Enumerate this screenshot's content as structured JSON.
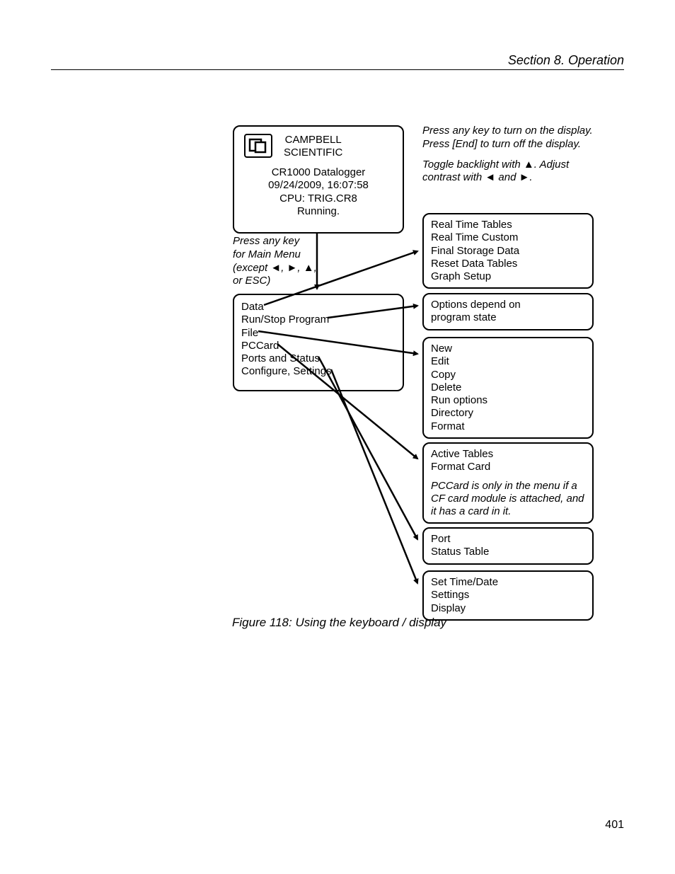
{
  "header": {
    "section": "Section 8.  Operation"
  },
  "pageNumber": "401",
  "caption": "Figure 118: Using the keyboard / display",
  "topInstr": {
    "l1": "Press any key to turn on the display.",
    "l2": "Press [End] to turn off the display.",
    "l3": "Toggle backlight with ▲. Adjust contrast with ◄ and ►."
  },
  "boxA": {
    "brand1": "CAMPBELL",
    "brand2": "SCIENTIFIC",
    "l1": "CR1000 Datalogger",
    "l2": "09/24/2009,  16:07:58",
    "l3": "CPU:  TRIG.CR8",
    "l4": "Running."
  },
  "sideInstr": {
    "l1": "Press any key",
    "l2": "for Main Menu",
    "l3": "(except ◄, ►, ▲,",
    "l4": "or ESC)"
  },
  "boxB": {
    "i0": "Data",
    "i1": "Run/Stop Program",
    "i2": "File",
    "i3": "PCCard",
    "i4": "Ports and Status",
    "i5": "Configure, Settings"
  },
  "boxC": {
    "i0": "Real Time Tables",
    "i1": "Real Time Custom",
    "i2": "Final Storage Data",
    "i3": "Reset Data Tables",
    "i4": "Graph Setup"
  },
  "boxD": {
    "i0": "Options depend on",
    "i1": "program state"
  },
  "boxE": {
    "i0": "New",
    "i1": "Edit",
    "i2": "Copy",
    "i3": "Delete",
    "i4": "Run options",
    "i5": "Directory",
    "i6": "Format"
  },
  "boxF": {
    "i0": "Active Tables",
    "i1": "Format Card",
    "note": "PCCard is only in the menu if a CF card module is attached, and it has a card in it."
  },
  "boxG": {
    "i0": "Port",
    "i1": "Status Table"
  },
  "boxH": {
    "i0": "Set Time/Date",
    "i1": "Settings",
    "i2": "Display"
  }
}
